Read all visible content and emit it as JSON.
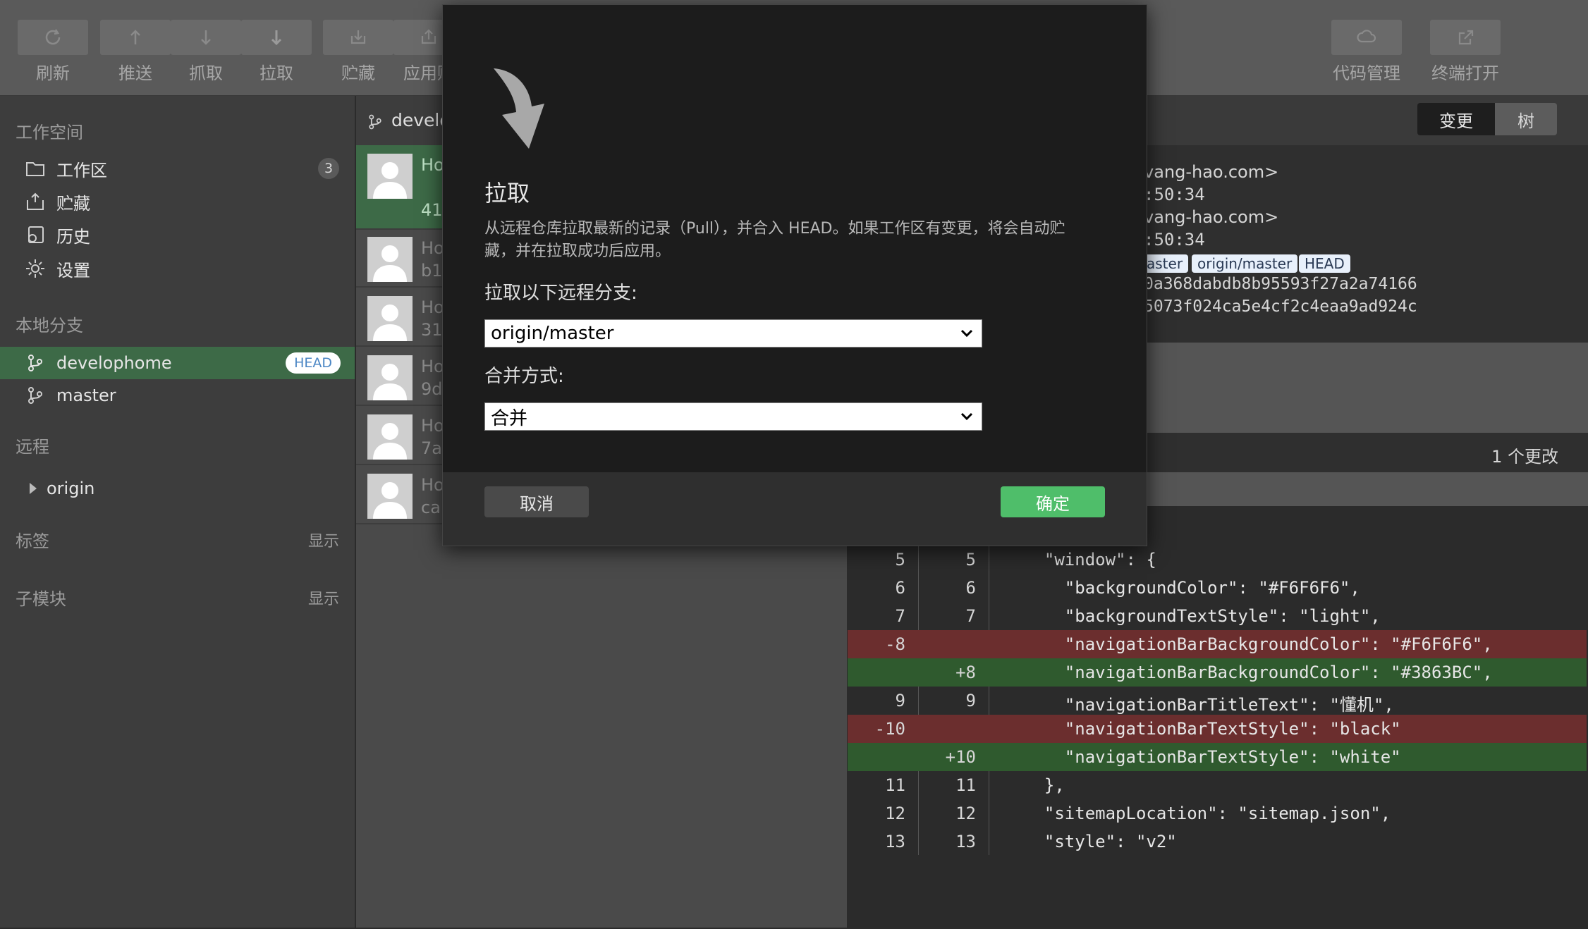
{
  "toolbar": {
    "refresh": "刷新",
    "push": "推送",
    "fetch": "抓取",
    "pull": "拉取",
    "stash": "贮藏",
    "apply_stash": "应用贮",
    "code_manage": "代码管理",
    "terminal_open": "终端打开"
  },
  "sidebar": {
    "workspace_title": "工作空间",
    "items": [
      {
        "label": "工作区",
        "count": "3"
      },
      {
        "label": "贮藏"
      },
      {
        "label": "历史"
      },
      {
        "label": "设置"
      }
    ],
    "local_branches_title": "本地分支",
    "branches": [
      {
        "label": "develophome",
        "badge": "HEAD"
      },
      {
        "label": "master"
      }
    ],
    "remote_title": "远程",
    "remote_origin": "origin",
    "tags_title": "标签",
    "tags_toggle": "显示",
    "submodules_title": "子模块",
    "submodules_toggle": "显示"
  },
  "branch_header": "develo",
  "commits": [
    {
      "t1": "Ho",
      "t2": "41("
    },
    {
      "t1": "Ho",
      "t2": "b18"
    },
    {
      "t1": "Ho",
      "t2": "31("
    },
    {
      "t1": "Ho",
      "t2": "9d"
    },
    {
      "t1": "Ho",
      "t2": "7a"
    },
    {
      "t1": "Ho",
      "t2": "ca"
    }
  ],
  "detail": {
    "view_changes": "变更",
    "view_tree": "树",
    "author_email": "vang-hao.com>",
    "author_time": ":50:34",
    "committer_email": "vang-hao.com>",
    "committer_time": ":50:34",
    "refs": [
      "aster",
      "origin/master",
      "HEAD"
    ],
    "hash1": "0a368dabdb8b95593f27a2a74166",
    "hash2": "5073f024ca5e4cf2c4eaa9ad924c",
    "change_count": "1 个更改"
  },
  "diff": [
    {
      "type": "ctx",
      "old": "5",
      "new": "5",
      "code": "  \"window\": {"
    },
    {
      "type": "ctx",
      "old": "6",
      "new": "6",
      "code": "    \"backgroundColor\": \"#F6F6F6\","
    },
    {
      "type": "ctx",
      "old": "7",
      "new": "7",
      "code": "    \"backgroundTextStyle\": \"light\","
    },
    {
      "type": "del",
      "old": "-8",
      "new": "",
      "code": "    \"navigationBarBackgroundColor\": \"#F6F6F6\","
    },
    {
      "type": "add",
      "old": "",
      "new": "+8",
      "code": "    \"navigationBarBackgroundColor\": \"#3863BC\","
    },
    {
      "type": "ctx",
      "old": "9",
      "new": "9",
      "code": "    \"navigationBarTitleText\": \"懂机\","
    },
    {
      "type": "del",
      "old": "-10",
      "new": "",
      "code": "    \"navigationBarTextStyle\": \"black\""
    },
    {
      "type": "add",
      "old": "",
      "new": "+10",
      "code": "    \"navigationBarTextStyle\": \"white\""
    },
    {
      "type": "ctx",
      "old": "11",
      "new": "11",
      "code": "  },"
    },
    {
      "type": "ctx",
      "old": "12",
      "new": "12",
      "code": "  \"sitemapLocation\": \"sitemap.json\","
    },
    {
      "type": "ctx",
      "old": "13",
      "new": "13",
      "code": "  \"style\": \"v2\""
    }
  ],
  "dialog": {
    "title": "拉取",
    "description": "从远程仓库拉取最新的记录（Pull），并合入 HEAD。如果工作区有变更，将会自动贮藏，并在拉取成功后应用。",
    "branch_label": "拉取以下远程分支:",
    "branch_value": "origin/master",
    "merge_label": "合并方式:",
    "merge_value": "合并",
    "cancel": "取消",
    "confirm": "确定"
  }
}
